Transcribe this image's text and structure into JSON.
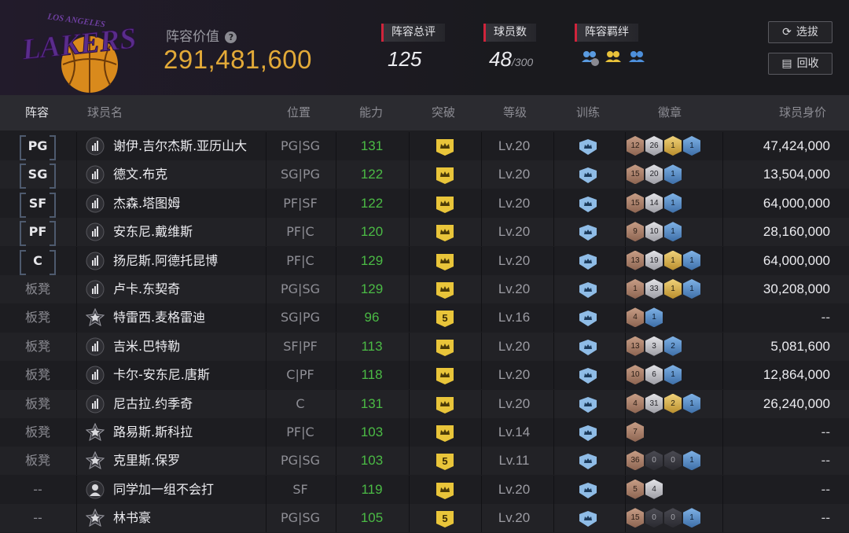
{
  "header": {
    "logo_text": "LAKERS",
    "logo_arc_text": "LOS ANGELES",
    "value_label": "阵容价值",
    "value_help_icon": "question-circle-icon",
    "value": "291,481,600",
    "rating_label": "阵容总评",
    "rating_value": "125",
    "players_label": "球员数",
    "players_value": "48",
    "players_max": "/300",
    "bond_label": "阵容羁绊",
    "bond_icons": [
      "team-bond-icon-blue",
      "team-bond-icon-gold",
      "team-bond-icon-blue-2"
    ],
    "draft_button": "选拔",
    "draft_icon": "refresh-icon",
    "recycle_button": "回收",
    "recycle_icon": "cards-icon"
  },
  "columns": [
    "阵容",
    "球员名",
    "位置",
    "能力",
    "突破",
    "等级",
    "训练",
    "徽章",
    "球员身价"
  ],
  "colors": {
    "accent_gold": "#e3aa38",
    "ability_green": "#4bbb45",
    "label_red": "#d0243b"
  },
  "rows": [
    {
      "slot": "PG",
      "starter": true,
      "icon": "bars-icon",
      "name": "谢伊.吉尔杰斯.亚历山大",
      "pos": "PG|SG",
      "ability": "131",
      "breakthrough": "crown",
      "level": "Lv.20",
      "badges": [
        [
          "bronze",
          "12"
        ],
        [
          "silver",
          "26"
        ],
        [
          "gold",
          "1"
        ],
        [
          "blue",
          "1"
        ]
      ],
      "salary": "47,424,000"
    },
    {
      "slot": "SG",
      "starter": true,
      "icon": "bars-icon",
      "name": "德文.布克",
      "pos": "SG|PG",
      "ability": "122",
      "breakthrough": "crown",
      "level": "Lv.20",
      "badges": [
        [
          "bronze",
          "15"
        ],
        [
          "silver",
          "20"
        ],
        [
          "blue",
          "1"
        ]
      ],
      "salary": "13,504,000"
    },
    {
      "slot": "SF",
      "starter": true,
      "icon": "bars-icon",
      "name": "杰森.塔图姆",
      "pos": "PF|SF",
      "ability": "122",
      "breakthrough": "crown",
      "level": "Lv.20",
      "badges": [
        [
          "bronze",
          "15"
        ],
        [
          "silver",
          "14"
        ],
        [
          "blue",
          "1"
        ]
      ],
      "salary": "64,000,000"
    },
    {
      "slot": "PF",
      "starter": true,
      "icon": "bars-icon",
      "name": "安东尼.戴维斯",
      "pos": "PF|C",
      "ability": "120",
      "breakthrough": "crown",
      "level": "Lv.20",
      "badges": [
        [
          "bronze",
          "9"
        ],
        [
          "silver",
          "10"
        ],
        [
          "blue",
          "1"
        ]
      ],
      "salary": "28,160,000"
    },
    {
      "slot": "C",
      "starter": true,
      "icon": "bars-icon",
      "name": "扬尼斯.阿德托昆博",
      "pos": "PF|C",
      "ability": "129",
      "breakthrough": "crown",
      "level": "Lv.20",
      "badges": [
        [
          "bronze",
          "13"
        ],
        [
          "silver",
          "19"
        ],
        [
          "gold",
          "1"
        ],
        [
          "blue",
          "1"
        ]
      ],
      "salary": "64,000,000"
    },
    {
      "slot": "板凳",
      "starter": false,
      "icon": "bars-icon",
      "name": "卢卡.东契奇",
      "pos": "PG|SG",
      "ability": "129",
      "breakthrough": "crown",
      "level": "Lv.20",
      "badges": [
        [
          "bronze",
          "1"
        ],
        [
          "silver",
          "33"
        ],
        [
          "gold",
          "1"
        ],
        [
          "blue",
          "1"
        ]
      ],
      "salary": "30,208,000"
    },
    {
      "slot": "板凳",
      "starter": false,
      "icon": "star-badge-icon",
      "name": "特雷西.麦格雷迪",
      "pos": "SG|PG",
      "ability": "96",
      "breakthrough": "5",
      "level": "Lv.16",
      "badges": [
        [
          "bronze",
          "4"
        ],
        [
          "blue",
          "1"
        ]
      ],
      "salary": "--"
    },
    {
      "slot": "板凳",
      "starter": false,
      "icon": "bars-icon",
      "name": "吉米.巴特勒",
      "pos": "SF|PF",
      "ability": "113",
      "breakthrough": "crown",
      "level": "Lv.20",
      "badges": [
        [
          "bronze",
          "13"
        ],
        [
          "silver",
          "3"
        ],
        [
          "blue",
          "2"
        ]
      ],
      "salary": "5,081,600"
    },
    {
      "slot": "板凳",
      "starter": false,
      "icon": "bars-icon",
      "name": "卡尔-安东尼.唐斯",
      "pos": "C|PF",
      "ability": "118",
      "breakthrough": "crown",
      "level": "Lv.20",
      "badges": [
        [
          "bronze",
          "10"
        ],
        [
          "silver",
          "6"
        ],
        [
          "blue",
          "1"
        ]
      ],
      "salary": "12,864,000"
    },
    {
      "slot": "板凳",
      "starter": false,
      "icon": "bars-icon",
      "name": "尼古拉.约季奇",
      "pos": "C",
      "ability": "131",
      "breakthrough": "crown",
      "level": "Lv.20",
      "badges": [
        [
          "bronze",
          "4"
        ],
        [
          "silver",
          "31"
        ],
        [
          "gold",
          "2"
        ],
        [
          "blue",
          "1"
        ]
      ],
      "salary": "26,240,000"
    },
    {
      "slot": "板凳",
      "starter": false,
      "icon": "star-badge-icon",
      "name": "路易斯.斯科拉",
      "pos": "PF|C",
      "ability": "103",
      "breakthrough": "crown",
      "level": "Lv.14",
      "badges": [
        [
          "bronze",
          "7"
        ]
      ],
      "salary": "--"
    },
    {
      "slot": "板凳",
      "starter": false,
      "icon": "star-badge-icon",
      "name": "克里斯.保罗",
      "pos": "PG|SG",
      "ability": "103",
      "breakthrough": "5",
      "level": "Lv.11",
      "badges": [
        [
          "bronze",
          "36"
        ],
        [
          "dark",
          "0"
        ],
        [
          "dark",
          "0"
        ],
        [
          "blue",
          "1"
        ]
      ],
      "salary": "--"
    },
    {
      "slot": "--",
      "starter": false,
      "icon": "person-icon",
      "name": "同学加一组不会打",
      "pos": "SF",
      "ability": "119",
      "breakthrough": "crown",
      "level": "Lv.20",
      "badges": [
        [
          "bronze",
          "5"
        ],
        [
          "silver",
          "4"
        ]
      ],
      "salary": "--"
    },
    {
      "slot": "--",
      "starter": false,
      "icon": "star-badge-icon",
      "name": "林书豪",
      "pos": "PG|SG",
      "ability": "105",
      "breakthrough": "5",
      "level": "Lv.20",
      "badges": [
        [
          "bronze",
          "15"
        ],
        [
          "dark",
          "0"
        ],
        [
          "dark",
          "0"
        ],
        [
          "blue",
          "1"
        ]
      ],
      "salary": "--"
    }
  ]
}
